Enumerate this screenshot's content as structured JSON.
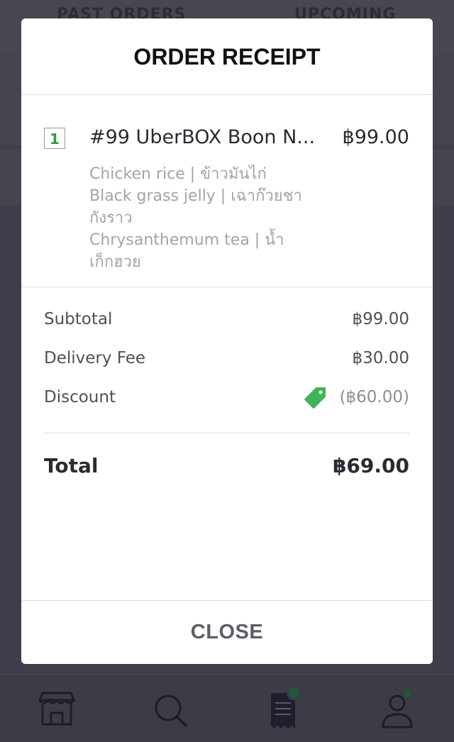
{
  "background": {
    "tabs": [
      "PAST ORDERS",
      "UPCOMING"
    ]
  },
  "modal": {
    "title": "ORDER RECEIPT",
    "item": {
      "quantity": "1",
      "name": "#99 UberBOX Boon N...",
      "price": "฿99.00",
      "details": [
        "Chicken rice | ข้าวมันไก่",
        "Black grass jelly | เฉาก๊วยชา กังราว",
        "Chrysanthemum tea | น้ำ เก็กฮวย"
      ]
    },
    "summary": {
      "subtotal_label": "Subtotal",
      "subtotal_value": "฿99.00",
      "delivery_label": "Delivery Fee",
      "delivery_value": "฿30.00",
      "discount_label": "Discount",
      "discount_value": "(฿60.00)",
      "total_label": "Total",
      "total_value": "฿69.00"
    },
    "close_label": "CLOSE"
  },
  "nav": {
    "items": [
      "store-icon",
      "search-icon",
      "receipt-icon",
      "profile-icon"
    ],
    "active_index": 2
  },
  "colors": {
    "accent_green": "#3fb55a",
    "qty_green": "#2f9b3a",
    "overlay": "#3f3f4c",
    "nav_active": "#1e1e2e"
  }
}
